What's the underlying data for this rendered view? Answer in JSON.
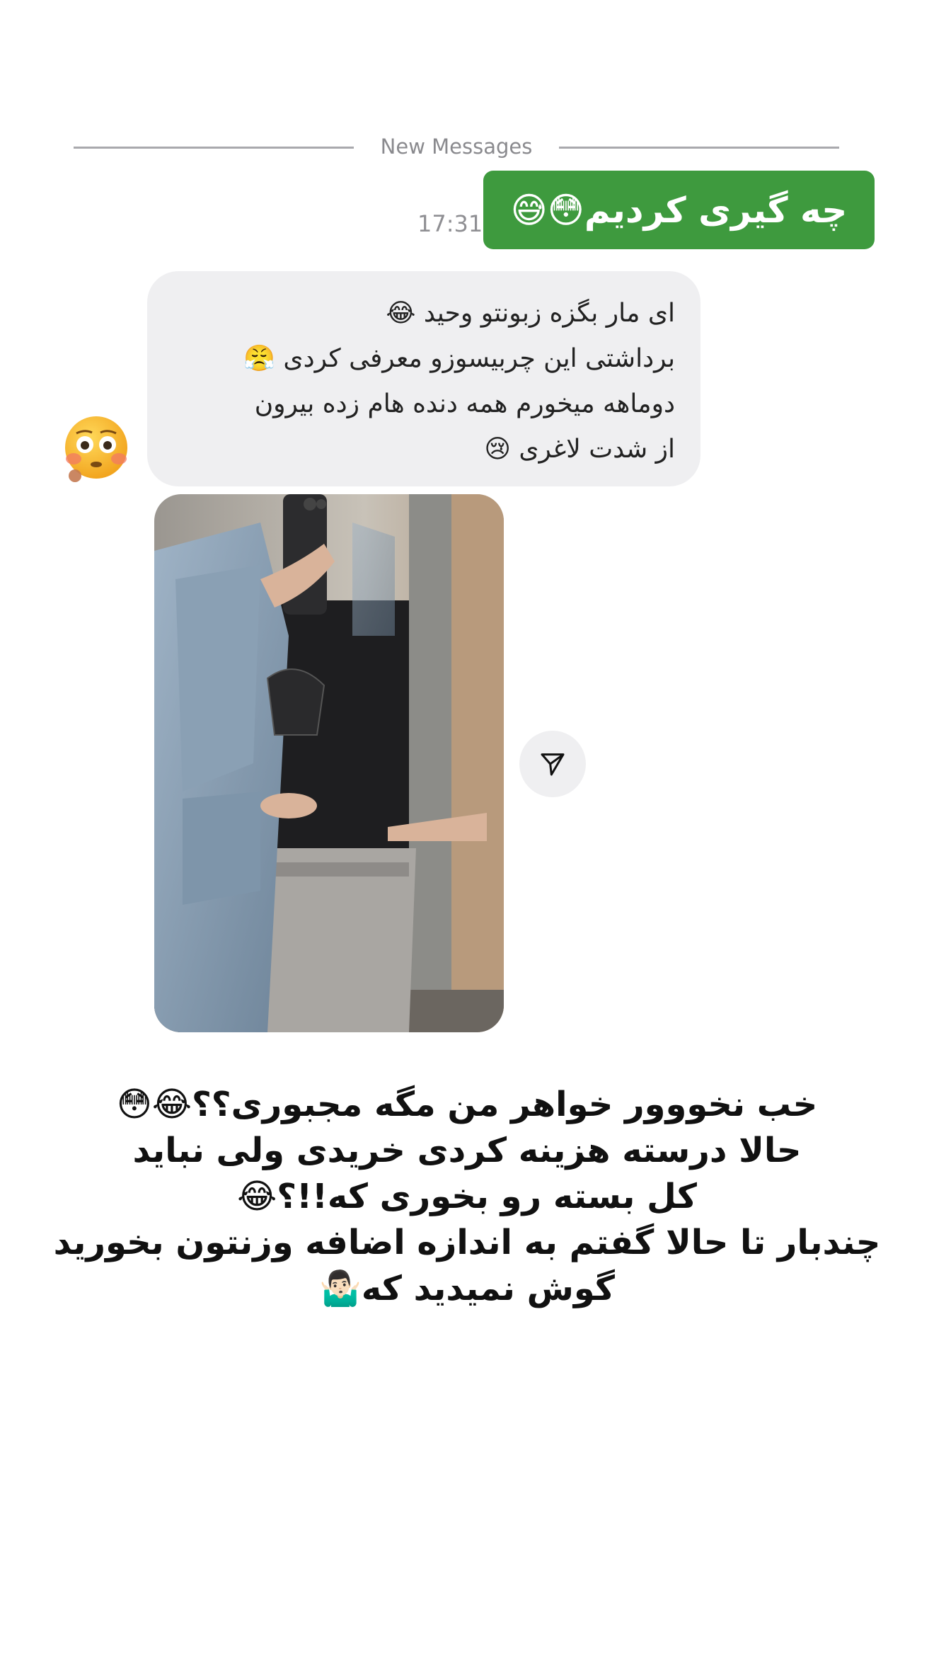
{
  "divider": {
    "label": "New Messages"
  },
  "sent_message": {
    "text": "چه گیری کردیم😳😅",
    "time": "17:31"
  },
  "received_message": {
    "lines": [
      "ای مار بگزه زبونتو وحید 😂",
      "برداشتی این چربیسوزو معرفی کردی 😤",
      "دوماهه میخورم همه دنده هام زده بیرون",
      "از شدت لاغری 😢"
    ]
  },
  "avatar": {
    "emoji": "😳"
  },
  "shared_post": {
    "share_icon": "paper-plane-icon"
  },
  "caption": {
    "lines": [
      "خب نخووور خواهر من مگه مجبوری؟؟😂😳",
      "حالا درسته هزینه کردی خریدی ولی نباید",
      "کل بسته رو بخوری که!!؟😂",
      "چندبار تا حالا گفتم به اندازه اضافه وزنتون بخورید",
      "گوش نمیدید که🤷🏻‍♂️"
    ]
  },
  "colors": {
    "sent_bubble": "#3e9a3e",
    "received_bubble": "#efeff1",
    "divider": "#a9a9ad"
  }
}
